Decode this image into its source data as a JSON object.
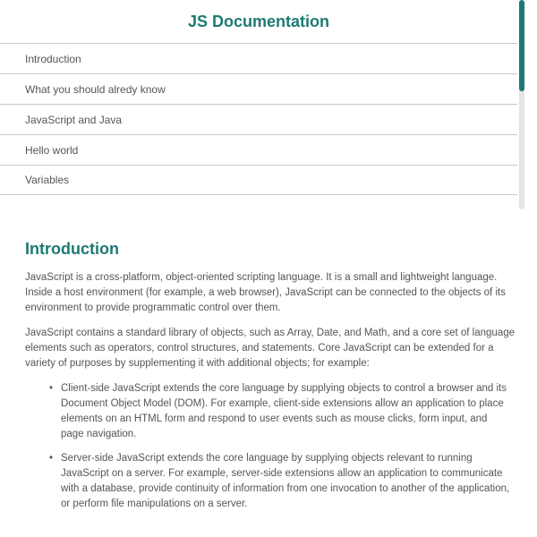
{
  "nav": {
    "title": "JS Documentation",
    "links": [
      {
        "label": "Introduction"
      },
      {
        "label": "What you should alredy know"
      },
      {
        "label": "JavaScript and Java"
      },
      {
        "label": "Hello world"
      },
      {
        "label": "Variables"
      }
    ],
    "scroll_position": 0.0,
    "accent_color": "#1d7a73"
  },
  "main": {
    "section_heading": "Introduction",
    "paragraphs": [
      "JavaScript is a cross-platform, object-oriented scripting language. It is a small and lightweight language. Inside a host environment (for example, a web browser), JavaScript can be connected to the objects of its environment to provide programmatic control over them.",
      "JavaScript contains a standard library of objects, such as Array, Date, and Math, and a core set of language elements such as operators, control structures, and statements. Core JavaScript can be extended for a variety of purposes by supplementing it with additional objects; for example:"
    ],
    "bullets": [
      "Client-side JavaScript extends the core language by supplying objects to control a browser and its Document Object Model (DOM). For example, client-side extensions allow an application to place elements on an HTML form and respond to user events such as mouse clicks, form input, and page navigation.",
      "Server-side JavaScript extends the core language by supplying objects relevant to running JavaScript on a server. For example, server-side extensions allow an application to communicate with a database, provide continuity of information from one invocation to another of the application, or perform file manipulations on a server."
    ],
    "bullet_glyph": "•"
  }
}
